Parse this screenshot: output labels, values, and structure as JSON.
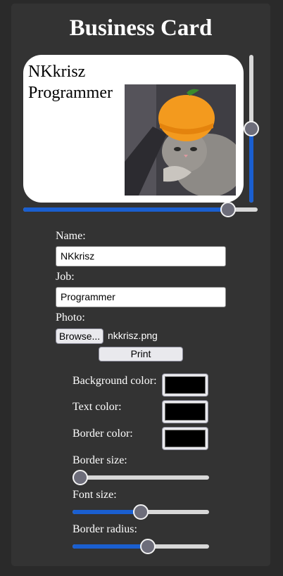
{
  "header": {
    "title": "Business Card"
  },
  "card": {
    "name": "NKkrisz",
    "job": "Programmer",
    "height_slider_fraction": 0.5,
    "width_slider_fraction": 0.9
  },
  "form": {
    "name_label": "Name:",
    "name_value": "NKkrisz",
    "job_label": "Job:",
    "job_value": "Programmer",
    "photo_label": "Photo:",
    "browse_label": "Browse...",
    "file_name": "nkkrisz.png",
    "print_label": "Print"
  },
  "style": {
    "background_color_label": "Background color:",
    "background_color": "#000000",
    "text_color_label": "Text color:",
    "text_color": "#000000",
    "border_color_label": "Border color:",
    "border_color": "#000000",
    "border_size_label": "Border size:",
    "border_size_fraction": 0.0,
    "font_size_label": "Font size:",
    "font_size_fraction": 0.5,
    "border_radius_label": "Border radius:",
    "border_radius_fraction": 0.56
  },
  "colors": {
    "accent": "#1a5fd0",
    "panel": "#333333",
    "background": "#2a2a2a"
  }
}
